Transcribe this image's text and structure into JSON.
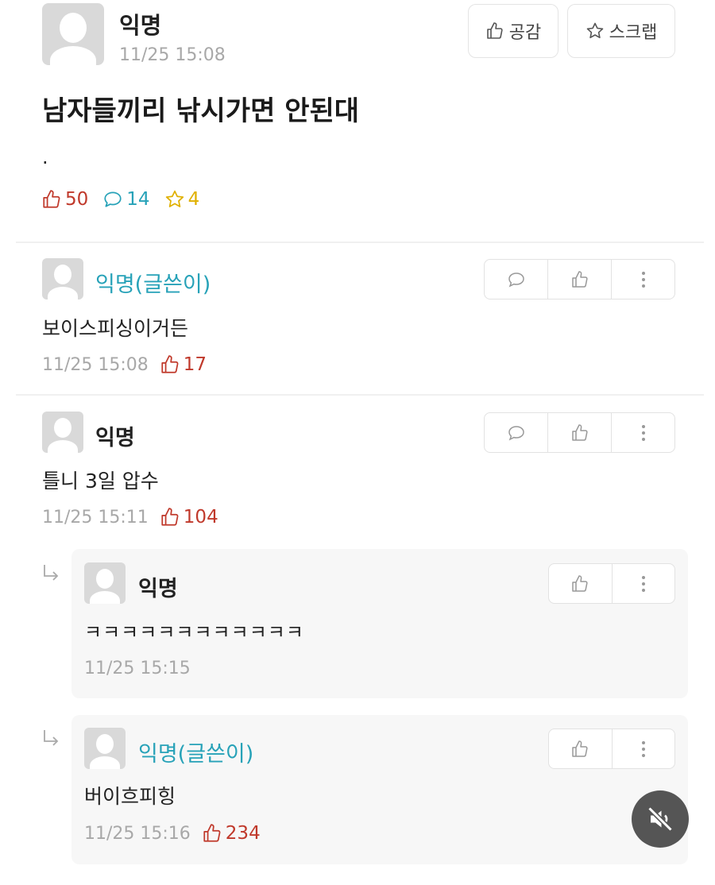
{
  "post": {
    "author": "익명",
    "time": "11/25 15:08",
    "like_button_label": "공감",
    "scrap_button_label": "스크랩",
    "title": "남자들끼리 낚시가면 안된대",
    "body": ".",
    "likes": "50",
    "comments": "14",
    "scraps": "4"
  },
  "comments": [
    {
      "author": "익명(글쓴이)",
      "text": "보이스피싱이거든",
      "time": "11/25 15:08",
      "likes": "17"
    },
    {
      "author": "익명",
      "text": "틀니 3일 압수",
      "time": "11/25 15:11",
      "likes": "104"
    }
  ],
  "replies": [
    {
      "author": "익명",
      "text": "ㅋㅋㅋㅋㅋㅋㅋㅋㅋㅋㅋㅋ",
      "time": "11/25 15:15"
    },
    {
      "author": "익명(글쓴이)",
      "text": "버이흐피힝",
      "time": "11/25 15:16",
      "likes": "234"
    }
  ],
  "colors": {
    "op_name": "#27a2b8",
    "like": "#c0392b",
    "comment": "#27a2b8",
    "scrap": "#e0b000",
    "meta": "#a8a8a8"
  },
  "icons": [
    "thumbs-up-icon",
    "star-icon",
    "speech-bubble-icon",
    "more-vertical-icon",
    "reply-arrow-icon",
    "mute-icon"
  ]
}
